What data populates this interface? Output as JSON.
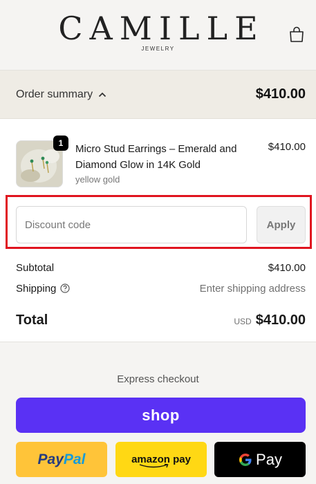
{
  "brand": {
    "name": "CAMILLE",
    "subtitle": "JEWELRY"
  },
  "header": {
    "cart_icon": "shopping-bag-icon"
  },
  "summary": {
    "toggle_label": "Order summary",
    "toggle_icon": "chevron-up-icon",
    "total": "$410.00"
  },
  "item": {
    "quantity": "1",
    "title": "Micro Stud Earrings – Emerald and Diamond Glow in 14K Gold",
    "variant": "yellow gold",
    "price": "$410.00"
  },
  "discount": {
    "placeholder": "Discount code",
    "value": "",
    "apply_label": "Apply"
  },
  "totals": {
    "subtotal_label": "Subtotal",
    "subtotal_value": "$410.00",
    "shipping_label": "Shipping",
    "shipping_value": "Enter shipping address",
    "total_label": "Total",
    "currency": "USD",
    "total_value": "$410.00"
  },
  "express": {
    "label": "Express checkout",
    "shop_label": "shop",
    "paypal_a": "Pay",
    "paypal_b": "Pal",
    "amazon_label": "amazon pay",
    "gpay_label": "Pay"
  },
  "colors": {
    "shop": "#5a31f4",
    "paypal": "#ffc439",
    "amazon": "#ffd814",
    "gpay": "#000000",
    "highlight": "#e0141f"
  }
}
